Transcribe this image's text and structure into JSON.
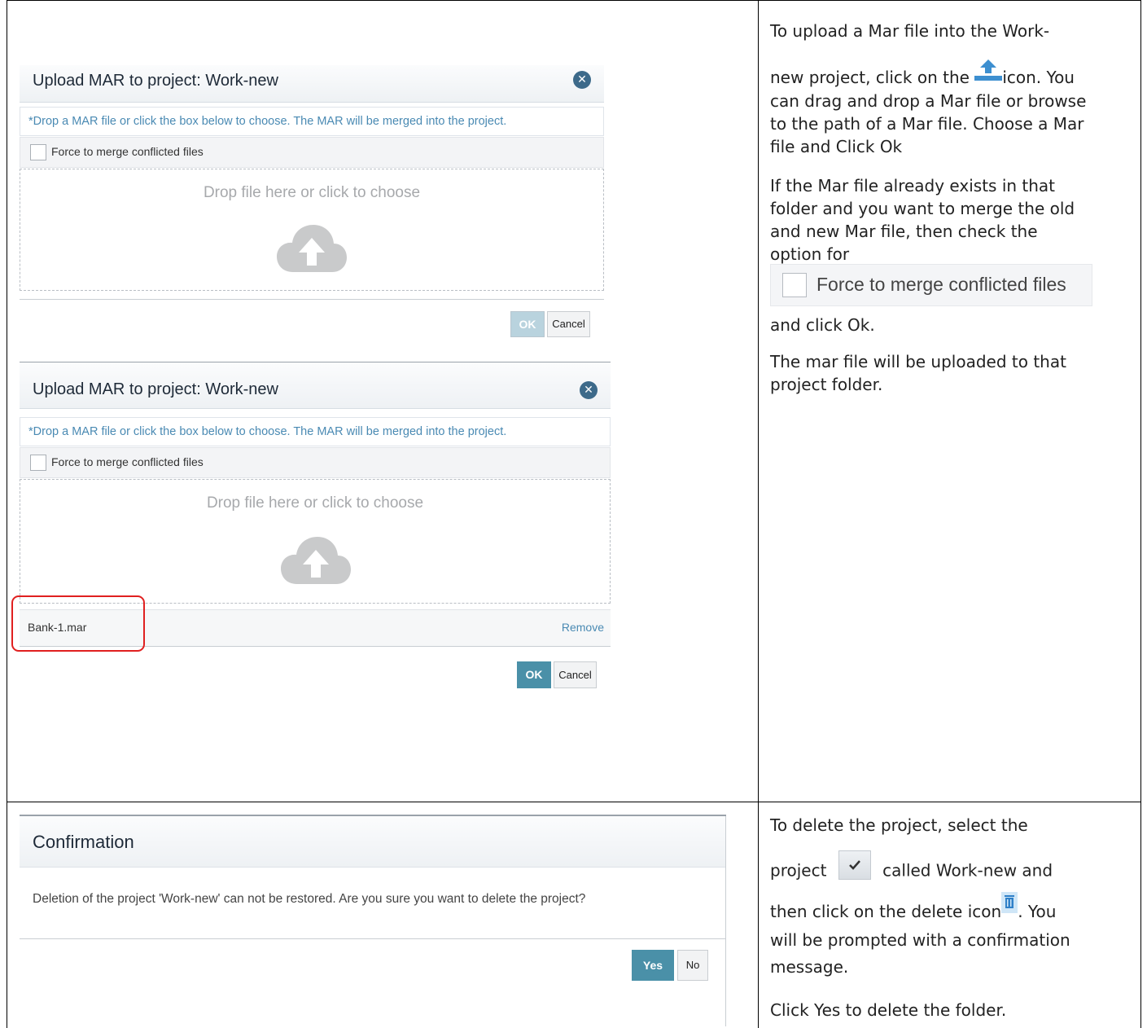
{
  "upload_dialog_1": {
    "title": "Upload MAR to project: Work-new",
    "note": "*Drop a MAR file or click the box below to choose. The MAR will be merged into the project.",
    "checkbox_label": "Force to merge conflicted files",
    "drop_text": "Drop file here or click to choose",
    "ok_label": "OK",
    "cancel_label": "Cancel"
  },
  "upload_dialog_2": {
    "title": "Upload MAR to project: Work-new",
    "note": "*Drop a MAR file or click the box below to choose. The MAR will be merged into the project.",
    "checkbox_label": "Force to merge conflicted files",
    "drop_text": "Drop file here or click to choose",
    "file_name": "Bank-1.mar",
    "remove_label": "Remove",
    "ok_label": "OK",
    "cancel_label": "Cancel"
  },
  "confirm_dialog": {
    "title": "Confirmation",
    "message": "Deletion of the project 'Work-new' can not be restored. Are you sure you want to delete the project?",
    "yes_label": "Yes",
    "no_label": "No"
  },
  "upload_instructions": {
    "line1": "To upload a Mar file into the Work-",
    "line2a": "new project, click on the",
    "line2b": "icon. You",
    "line3": "can drag and drop a Mar file or browse",
    "line4": "to the path of a Mar file. Choose a Mar",
    "line5": "file and Click Ok",
    "p2_line1": "If the Mar file already exists in that",
    "p2_line2": "folder and you want to merge the old",
    "p2_line3": "and new Mar file, then check the",
    "p2_line4": "option for",
    "force_label": "Force to merge conflicted files",
    "p3": "and click Ok.",
    "p4_line1": "The mar file will be uploaded to that",
    "p4_line2": "project folder."
  },
  "delete_instructions": {
    "line1": "To delete the project, select the",
    "line2a": "project",
    "line2b": "called Work-new and",
    "line3a": "then click on the delete icon",
    "line3b": ". You",
    "line4": "will be prompted with a confirmation",
    "line5": "message.",
    "line6": "Click Yes to delete the folder."
  },
  "icons": {
    "upload": "upload-icon",
    "close": "close-icon",
    "cloud_upload": "cloud-upload-icon",
    "check": "check-icon",
    "trash": "trash-icon"
  },
  "colors": {
    "accent": "#4a90a8",
    "link": "#4a8ab3",
    "ok_disabled": "#b9d3de",
    "highlight": "#e02020"
  }
}
